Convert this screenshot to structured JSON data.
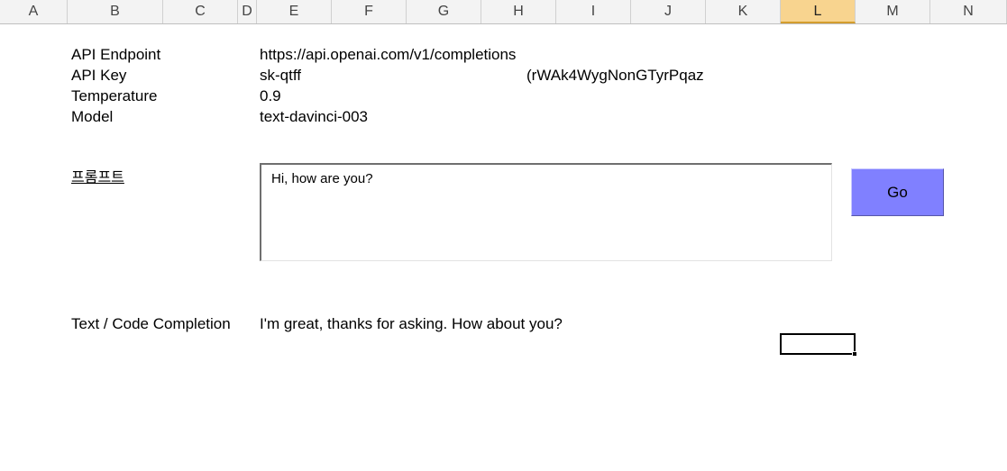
{
  "columns": [
    "A",
    "B",
    "C",
    "D",
    "E",
    "F",
    "G",
    "H",
    "I",
    "J",
    "K",
    "L",
    "M",
    "N"
  ],
  "selected_column": "L",
  "rows": {
    "endpoint_label": "API Endpoint",
    "endpoint_value": "https://api.openai.com/v1/completions",
    "key_label": "API Key",
    "key_value_start": "sk-qtff",
    "key_value_end": "(rWAk4WygNonGTyrPqaz",
    "temperature_label": "Temperature",
    "temperature_value": "0.9",
    "model_label": "Model",
    "model_value": "text-davinci-003"
  },
  "prompt": {
    "label": "프롬프트",
    "text": "Hi, how are you?",
    "button_label": "Go"
  },
  "completion": {
    "label": "Text / Code Completion",
    "value": "I'm great, thanks for asking. How about you?"
  }
}
